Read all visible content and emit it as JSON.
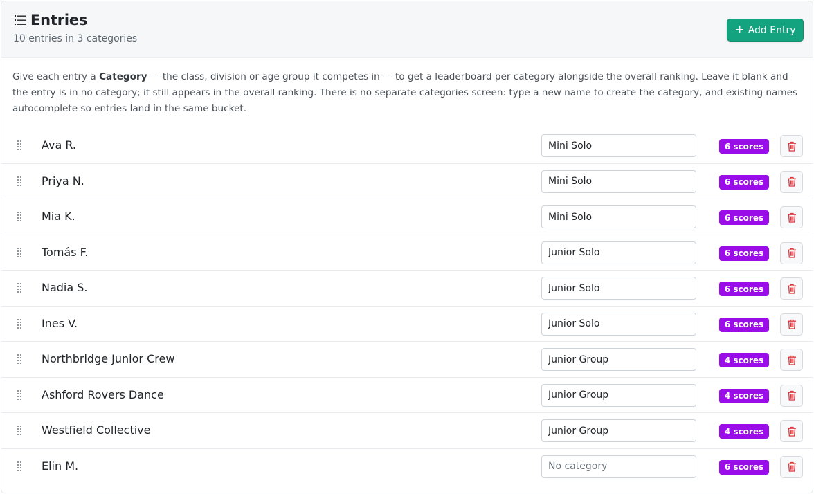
{
  "header": {
    "title": "Entries",
    "subtitle": "10 entries in 3 categories",
    "add_button_label": "Add Entry",
    "add_button_icon": "plus-icon",
    "title_icon": "list-icon"
  },
  "help": {
    "part1": "Give each entry a ",
    "bold": "Category",
    "part2": " — the class, division or age group it competes in — to get a leaderboard per category alongside the overall ranking. Leave it blank and the entry is in no category; it still appears in the overall ranking. There is no separate categories screen: type a new name to create the category, and existing names autocomplete so entries land in the same bucket."
  },
  "category_placeholder": "No category",
  "colors": {
    "accent_green": "#14a37f",
    "badge_purple": "#9b0de8",
    "delete_red": "#d9363e"
  },
  "entries": [
    {
      "name": "Ava R.",
      "category": "Mini Solo",
      "scores": "6 scores"
    },
    {
      "name": "Priya N.",
      "category": "Mini Solo",
      "scores": "6 scores"
    },
    {
      "name": "Mia K.",
      "category": "Mini Solo",
      "scores": "6 scores"
    },
    {
      "name": "Tomás F.",
      "category": "Junior Solo",
      "scores": "6 scores"
    },
    {
      "name": "Nadia S.",
      "category": "Junior Solo",
      "scores": "6 scores"
    },
    {
      "name": "Ines V.",
      "category": "Junior Solo",
      "scores": "6 scores"
    },
    {
      "name": "Northbridge Junior Crew",
      "category": "Junior Group",
      "scores": "4 scores"
    },
    {
      "name": "Ashford Rovers Dance",
      "category": "Junior Group",
      "scores": "4 scores"
    },
    {
      "name": "Westfield Collective",
      "category": "Junior Group",
      "scores": "4 scores"
    },
    {
      "name": "Elin M.",
      "category": "",
      "scores": "6 scores"
    }
  ]
}
